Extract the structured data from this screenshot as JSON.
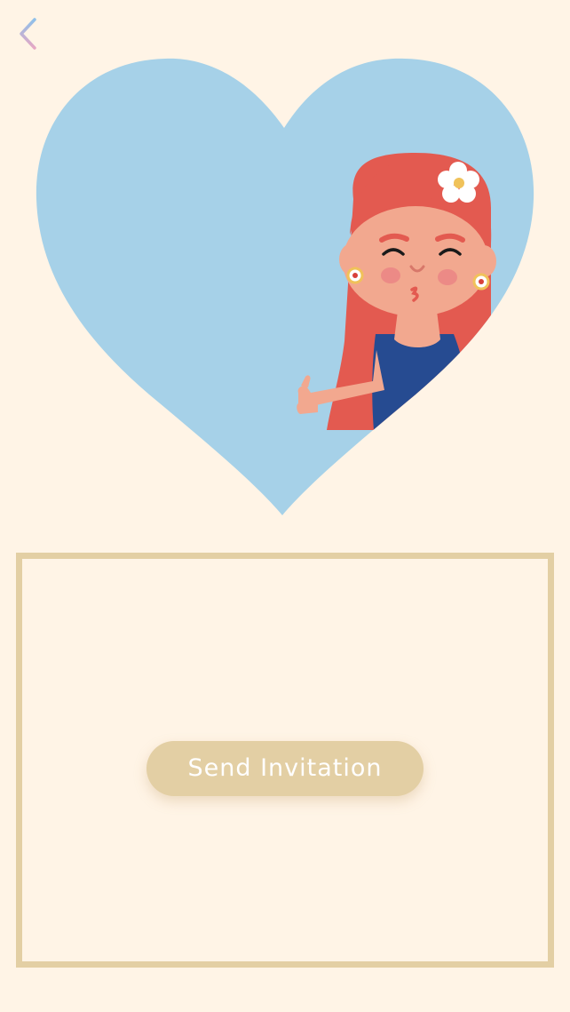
{
  "header": {
    "back_icon": "chevron-left-icon"
  },
  "hero": {
    "illustration": "girl-in-heart-illustration",
    "heart_color": "#a6d1e8",
    "hair_color": "#e35a50",
    "skin_color": "#f2a88f",
    "dress_color": "#264b91"
  },
  "panel": {
    "border_color": "#e3cfa4"
  },
  "actions": {
    "send_invitation_label": "Send Invitation"
  },
  "colors": {
    "background": "#fff4e6",
    "button": "#e3cfa4",
    "button_text": "#ffffff"
  }
}
